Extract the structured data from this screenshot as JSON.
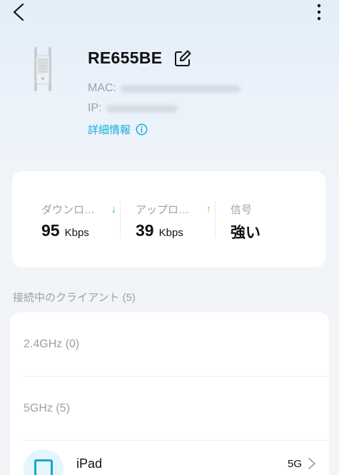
{
  "device": {
    "name": "RE655BE",
    "mac_label": "MAC:",
    "ip_label": "IP:",
    "details_link": "詳細情報"
  },
  "stats": {
    "download": {
      "label": "ダウンロ…",
      "arrow": "↓",
      "value": "95",
      "unit": "Kbps"
    },
    "upload": {
      "label": "アップロ…",
      "arrow": "↑",
      "value": "39",
      "unit": "Kbps"
    },
    "signal": {
      "label": "信号",
      "value": "強い"
    }
  },
  "clients": {
    "section_title": "接続中のクライアント (5)",
    "groups": [
      {
        "label": "2.4GHz (0)"
      },
      {
        "label": "5GHz (5)"
      }
    ],
    "items": [
      {
        "name": "iPad",
        "band": "5G"
      }
    ]
  },
  "colors": {
    "accent": "#14aee0",
    "download_arrow": "#35c06a",
    "upload_arrow": "#f0a020"
  },
  "icons": {
    "back": "chevron-left-icon",
    "more": "more-vertical-icon",
    "edit": "edit-icon",
    "info": "info-icon",
    "client": "tablet-icon"
  }
}
